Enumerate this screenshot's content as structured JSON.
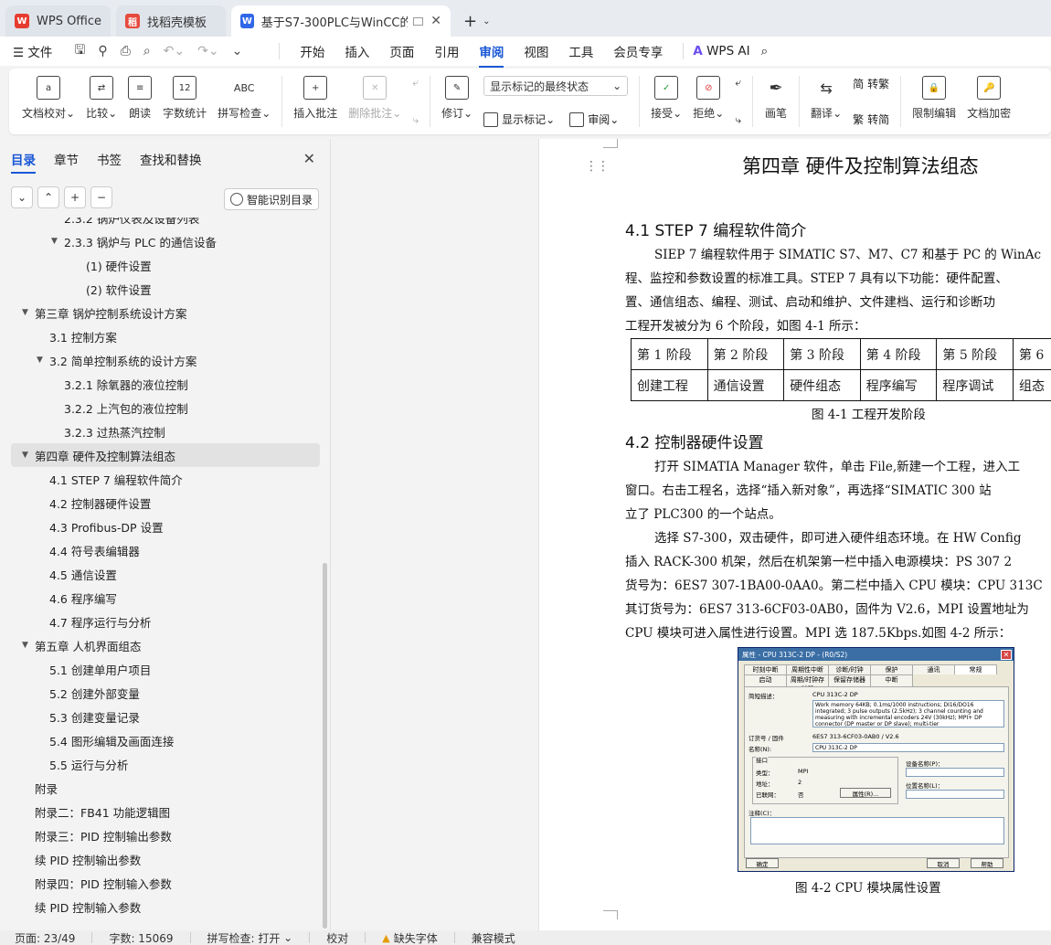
{
  "tabs": [
    {
      "label": "WPS Office",
      "icon": "wps-logo-icon",
      "color": "#e63b2e"
    },
    {
      "label": "找稻壳模板",
      "icon": "docer-icon",
      "color": "#e64a3c"
    },
    {
      "label": "基于S7-300PLC与WinCC的D",
      "icon": "writer-doc-icon",
      "color": "#2f67e8"
    }
  ],
  "menu": {
    "file": "文件",
    "items": [
      "开始",
      "插入",
      "页面",
      "引用",
      "审阅",
      "视图",
      "工具",
      "会员专享"
    ],
    "active": "审阅",
    "wps_ai": "WPS AI"
  },
  "ribbon": {
    "doc_check": "文档校对",
    "compare": "比较",
    "read_aloud": "朗读",
    "word_count": "字数统计",
    "spell_check": "拼写检查",
    "insert_comment": "插入批注",
    "delete_comment": "删除批注",
    "revise": "修订",
    "markup_dropdown": "显示标记的最终状态",
    "show_markup": "显示标记",
    "review": "审阅",
    "accept": "接受",
    "reject": "拒绝",
    "pen": "画笔",
    "translate": "翻译",
    "to_traditional": "转繁",
    "to_simplified": "转简",
    "restrict_edit": "限制编辑",
    "doc_encrypt": "文档加密",
    "icon_abc": "ABC",
    "icon_12": "12"
  },
  "sidebar": {
    "tabs": [
      "目录",
      "章节",
      "书签",
      "查找和替换"
    ],
    "smart_toc": "智能识别目录",
    "toc": [
      {
        "text": "2.3.2 锅炉仪表及设备列表",
        "level": 3,
        "arrow": false
      },
      {
        "text": "2.3.3 锅炉与 PLC 的通信设备",
        "level": 3,
        "arrow": true
      },
      {
        "text": "(1) 硬件设置",
        "level": 4,
        "arrow": false
      },
      {
        "text": "(2) 软件设置",
        "level": 4,
        "arrow": false
      },
      {
        "text": "第三章 锅炉控制系统设计方案",
        "level": 1,
        "arrow": true
      },
      {
        "text": "3.1 控制方案",
        "level": 2,
        "arrow": false
      },
      {
        "text": "3.2 简单控制系统的设计方案",
        "level": 2,
        "arrow": true
      },
      {
        "text": "3.2.1 除氧器的液位控制",
        "level": 3,
        "arrow": false
      },
      {
        "text": "3.2.2 上汽包的液位控制",
        "level": 3,
        "arrow": false
      },
      {
        "text": "3.2.3 过热蒸汽控制",
        "level": 3,
        "arrow": false
      },
      {
        "text": "第四章 硬件及控制算法组态",
        "level": 1,
        "arrow": true,
        "active": true
      },
      {
        "text": "4.1 STEP 7 编程软件简介",
        "level": 2,
        "arrow": false
      },
      {
        "text": "4.2 控制器硬件设置",
        "level": 2,
        "arrow": false
      },
      {
        "text": "4.3 Profibus-DP 设置",
        "level": 2,
        "arrow": false
      },
      {
        "text": "4.4 符号表编辑器",
        "level": 2,
        "arrow": false
      },
      {
        "text": "4.5 通信设置",
        "level": 2,
        "arrow": false
      },
      {
        "text": "4.6 程序编写",
        "level": 2,
        "arrow": false
      },
      {
        "text": "4.7 程序运行与分析",
        "level": 2,
        "arrow": false
      },
      {
        "text": "第五章 人机界面组态",
        "level": 1,
        "arrow": true
      },
      {
        "text": "5.1 创建单用户项目",
        "level": 2,
        "arrow": false
      },
      {
        "text": "5.2 创建外部变量",
        "level": 2,
        "arrow": false
      },
      {
        "text": "5.3 创建变量记录",
        "level": 2,
        "arrow": false
      },
      {
        "text": "5.4 图形编辑及画面连接",
        "level": 2,
        "arrow": false
      },
      {
        "text": "5.5 运行与分析",
        "level": 2,
        "arrow": false
      },
      {
        "text": "附录",
        "level": 1,
        "arrow": false
      },
      {
        "text": "附录二：FB41 功能逻辑图",
        "level": 1,
        "arrow": false
      },
      {
        "text": "附录三：PID 控制输出参数",
        "level": 1,
        "arrow": false
      },
      {
        "text": "续 PID 控制输出参数",
        "level": 1,
        "arrow": false
      },
      {
        "text": "附录四：PID 控制输入参数",
        "level": 1,
        "arrow": false
      },
      {
        "text": "续 PID 控制输入参数",
        "level": 1,
        "arrow": false
      }
    ]
  },
  "document": {
    "chapter_title": "第四章  硬件及控制算法组态",
    "sec1_title": "4.1  STEP 7 编程软件简介",
    "sec1_lines": [
      "SIEP 7 编程软件用于 SIMATIC S7、M7、C7 和基于 PC 的 WinAc",
      "程、监控和参数设置的标准工具。STEP 7 具有以下功能：硬件配置、",
      "置、通信组态、编程、测试、启动和维护、文件建档、运行和诊断功",
      "工程开发被分为 6 个阶段，如图 4-1 所示："
    ],
    "stages_row1": [
      "第 1 阶段",
      "第 2 阶段",
      "第 3 阶段",
      "第 4 阶段",
      "第 5 阶段",
      "第 6"
    ],
    "stages_row2": [
      "创建工程",
      "通信设置",
      "硬件组态",
      "程序编写",
      "程序调试",
      "组态"
    ],
    "fig1_caption": "图 4-1 工程开发阶段",
    "sec2_title": "4.2  控制器硬件设置",
    "sec2_lines": [
      "打开 SIMATIA Manager 软件，单击 File,新建一个工程，进入工",
      "窗口。右击工程名，选择“插入新对象”，再选择“SIMATIC 300 站",
      "立了 PLC300 的一个站点。",
      "选择 S7-300，双击硬件，即可进入硬件组态环境。在 HW Config",
      "插入 RACK-300 机架，然后在机架第一栏中插入电源模块：PS 307 2",
      "货号为：6ES7 307-1BA00-0AA0。第二栏中插入 CPU 模块：CPU 313C",
      "其订货号为：6ES7 313-6CF03-0AB0，固件为 V2.6，MPI 设置地址为",
      "CPU 模块可进入属性进行设置。MPI 选 187.5Kbps.如图 4-2 所示："
    ],
    "fig2_caption": "图 4-2 CPU 模块属性设置",
    "dialog": {
      "title": "属性 - CPU 313C-2 DP - (R0/S2)",
      "tabs": [
        "时刻中断",
        "周期性中断",
        "诊断/时钟",
        "保护",
        "通讯",
        "常规",
        "启动",
        "周期/时钟存储器",
        "保留存储器",
        "中断"
      ],
      "short_desc_label": "简短描述：",
      "short_desc": "CPU 313C-2 DP",
      "desc_text": "Work memory 64KB; 0.1ms/1000 instructions; DI16/DO16 integrated; 3 pulse outputs (2.5kHz); 3 channel counting and measuring with incremental encoders 24V (30kHz); MPI+ DP connector (DP master or DP slave); multi-tier",
      "order_label": "订货号 / 固件",
      "order_value": "6ES7 313-6CF03-0AB0 / V2.6",
      "name_label": "名称(N):",
      "name_value": "CPU 313C-2 DP",
      "interface_label": "接口",
      "type_label": "类型：",
      "type_value": "MPI",
      "address_label": "地址：",
      "address_value": "2",
      "networked_label": "已联网：",
      "networked_value": "否",
      "props_btn": "属性(R)...",
      "device_name_label": "设备名称(P)：",
      "location_label": "位置名称(L)：",
      "comment_label": "注释(C)：",
      "ok": "确定",
      "cancel": "取消",
      "help": "帮助"
    }
  },
  "status": {
    "page": "页面: 23/49",
    "words": "字数: 15069",
    "spell": "拼写检查: 打开",
    "proof": "校对",
    "missing_font": "缺失字体",
    "compat": "兼容模式"
  }
}
